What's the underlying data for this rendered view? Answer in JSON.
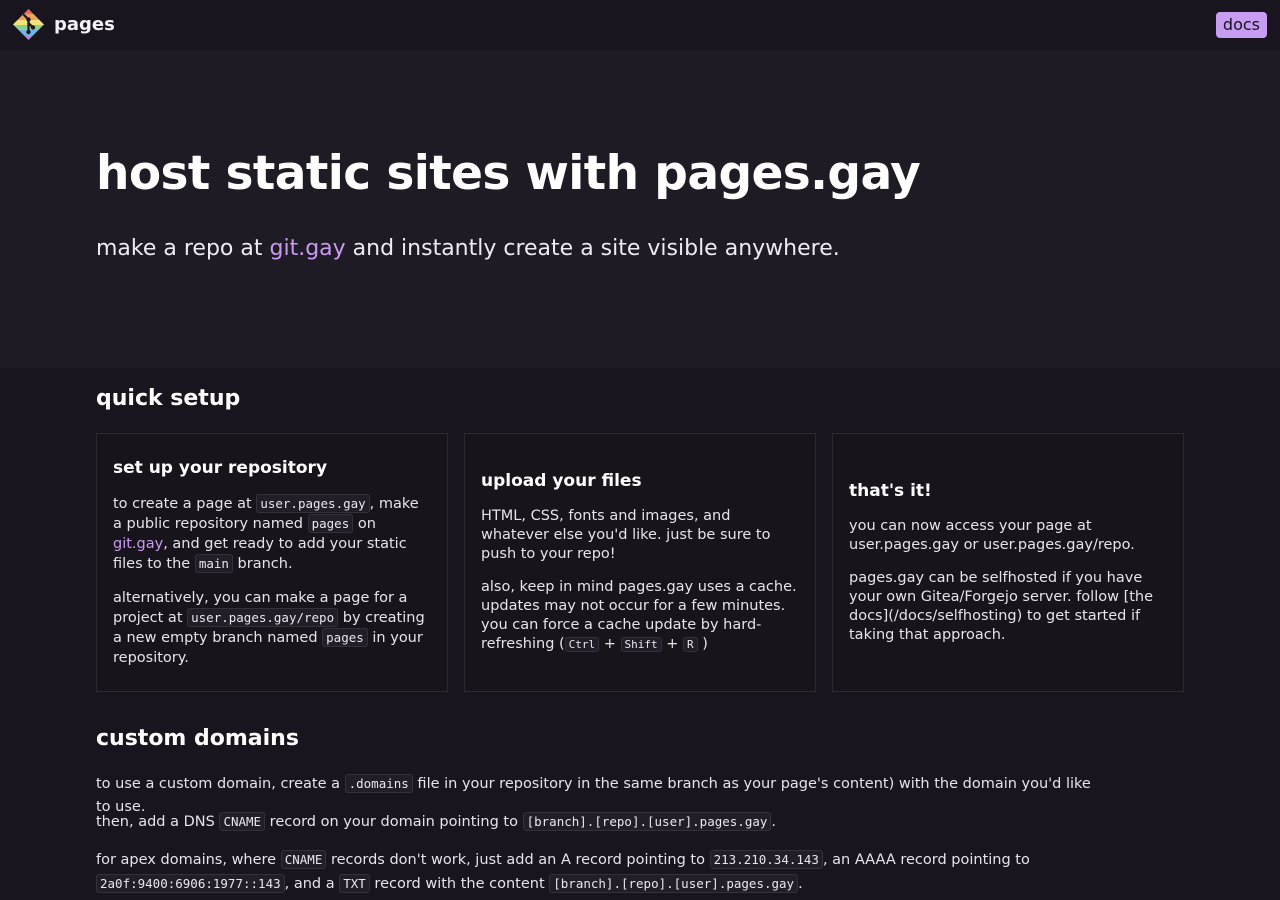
{
  "header": {
    "brand_name": "pages",
    "docs_label": "docs"
  },
  "hero": {
    "title": "host static sites with pages.gay",
    "subtitle_before": "make a repo at ",
    "subtitle_link": "git.gay",
    "subtitle_after": " and instantly create a site visible anywhere."
  },
  "quick_setup": {
    "heading": "quick setup",
    "card1": {
      "title": "set up your repository",
      "p1_a": "to create a page at ",
      "p1_code1": "user.pages.gay",
      "p1_b": ", make a public repository named ",
      "p1_code2": "pages",
      "p1_c": " on ",
      "p1_link": "git.gay",
      "p1_d": ", and get ready to add your static files to the ",
      "p1_code3": "main",
      "p1_e": " branch.",
      "p2_a": "alternatively, you can make a page for a project at ",
      "p2_code1": "user.pages.gay/repo",
      "p2_b": " by creating a new empty branch named ",
      "p2_code2": "pages",
      "p2_c": " in your repository."
    },
    "card2": {
      "title": "upload your files",
      "p1": "HTML, CSS, fonts and images, and whatever else you'd like. just be sure to push to your repo!",
      "p2_a": "also, keep in mind pages.gay uses a cache. updates may not occur for a few minutes. you can force a cache update by hard-refreshing (",
      "key1": "Ctrl",
      "plus1": " + ",
      "key2": "Shift",
      "plus2": " + ",
      "key3": "R",
      "p2_b": " )"
    },
    "card3": {
      "title": "that's it!",
      "p1": "you can now access your page at user.pages.gay or user.pages.gay/repo.",
      "p2": "pages.gay can be selfhosted if you have your own Gitea/Forgejo server. follow [the docs](/docs/selfhosting) to get started if taking that approach."
    }
  },
  "custom_domains": {
    "heading": "custom domains",
    "p1_a": "to use a custom domain, create a ",
    "p1_code": ".domains",
    "p1_b": " file in your repository in the same branch as your page's content) with the domain you'd like to use.",
    "p2_a": "then, add a DNS ",
    "p2_code1": "CNAME",
    "p2_b": " record on your domain pointing to ",
    "p2_code2": "[branch].[repo].[user].pages.gay",
    "p2_c": ".",
    "p3_a": "for apex domains, where ",
    "p3_code1": "CNAME",
    "p3_b": " records don't work, just add an A record pointing to ",
    "p3_code2": "213.210.34.143",
    "p3_c": ", an AAAA record pointing to ",
    "p3_code3": "2a0f:9400:6906:1977::143",
    "p3_d": ", and a ",
    "p3_code4": "TXT",
    "p3_e": " record with the content ",
    "p3_code5": "[branch].[repo].[user].pages.gay",
    "p3_f": "."
  }
}
